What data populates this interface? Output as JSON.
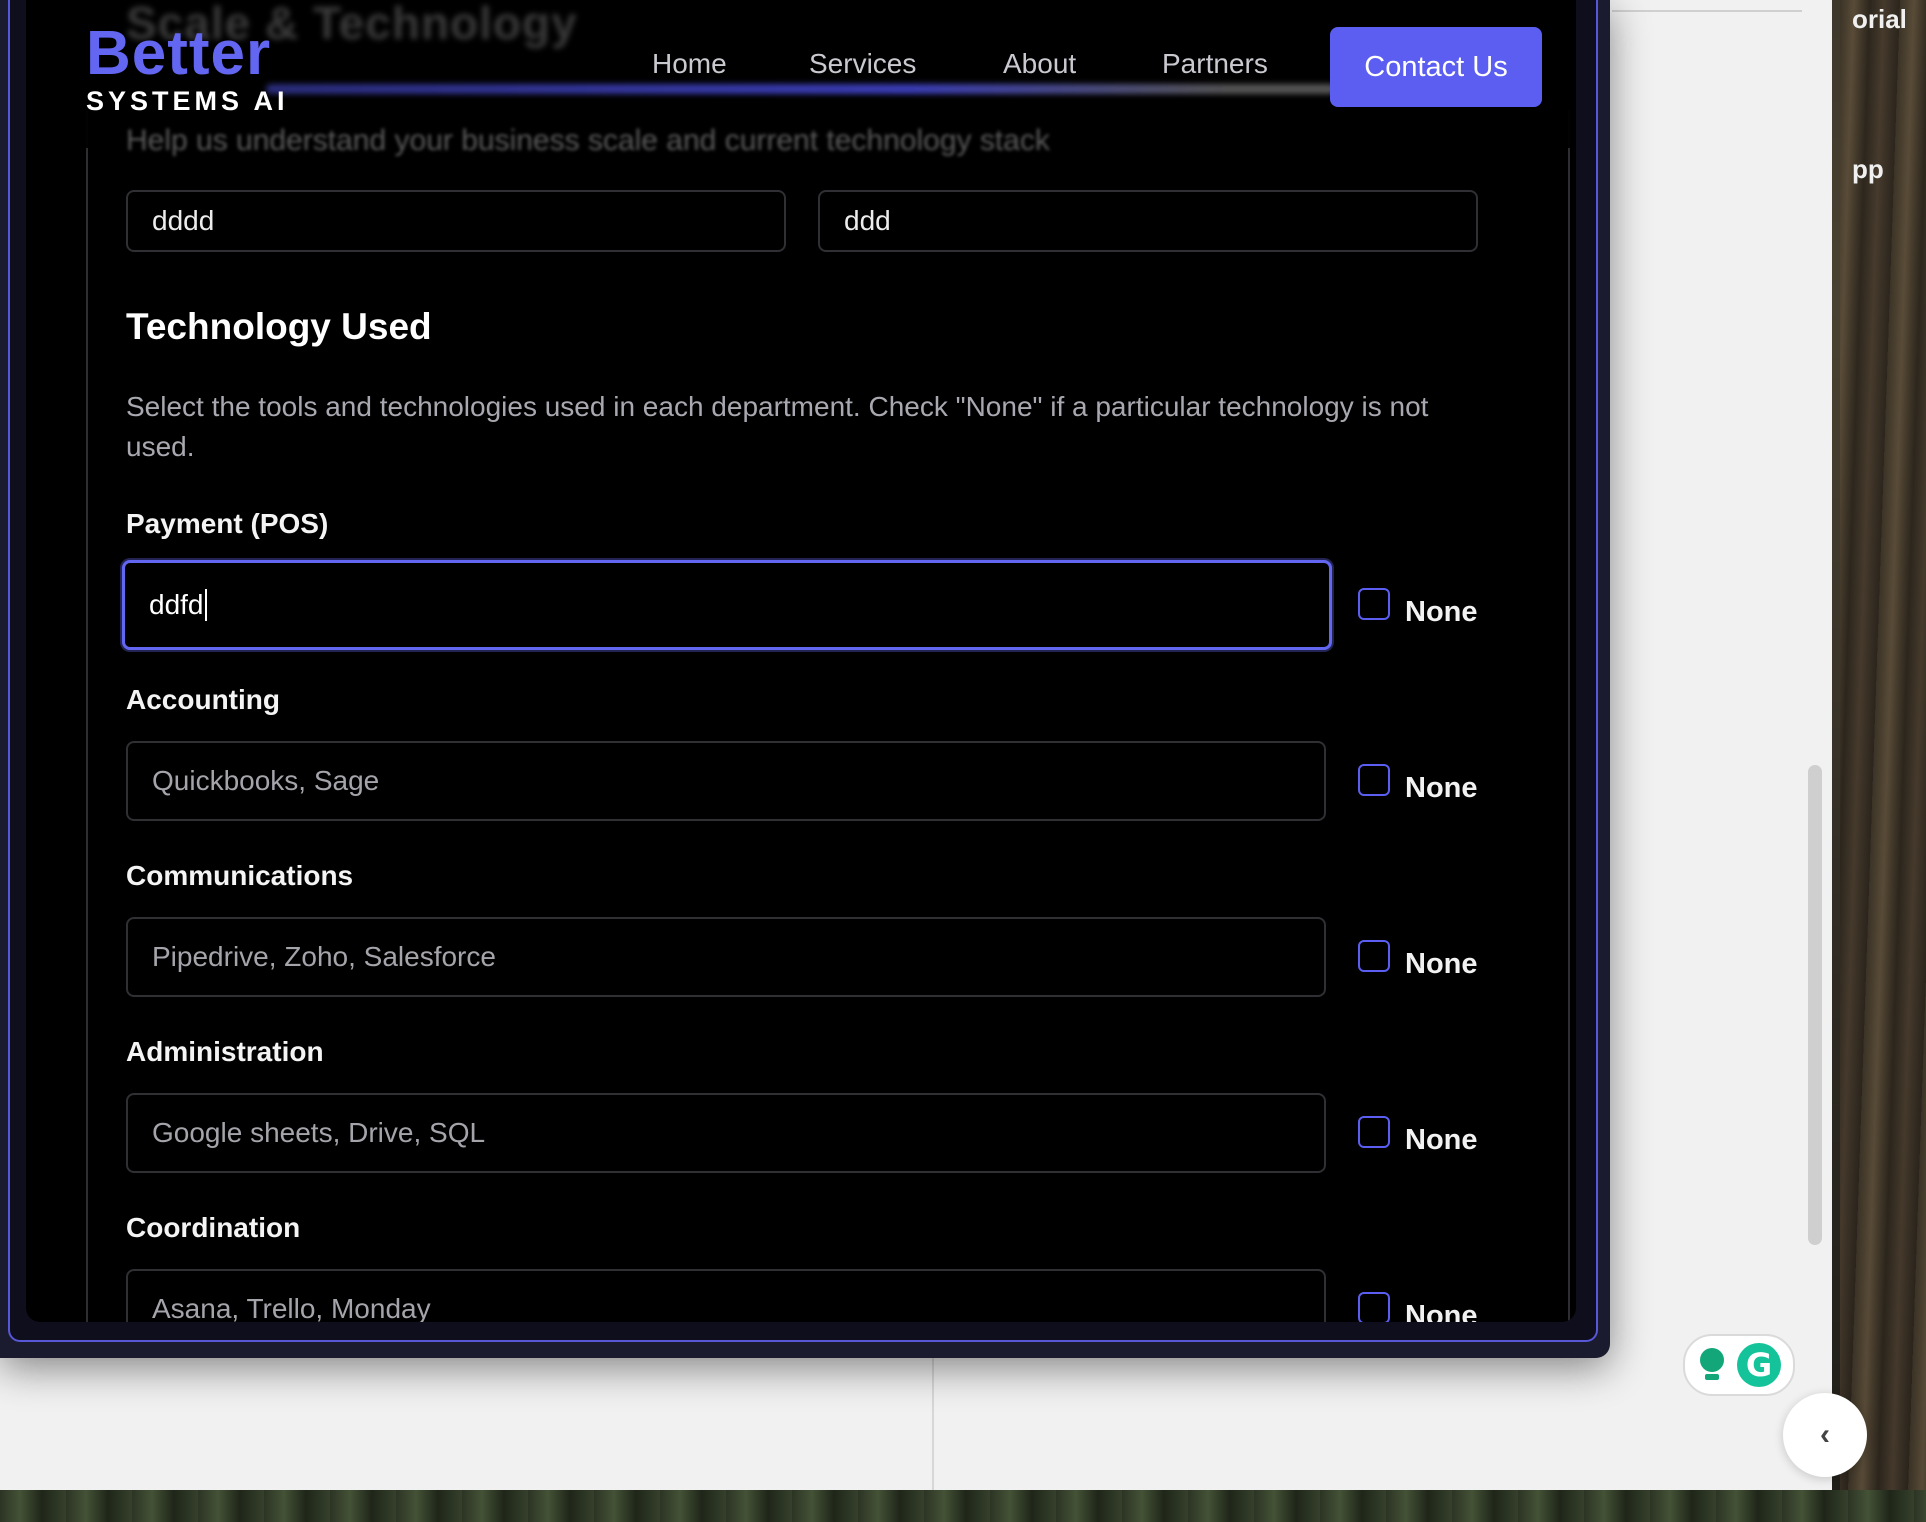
{
  "background": {
    "top_right_text": "orial",
    "mid_right_text": "pp"
  },
  "header": {
    "logo_main": "Better",
    "logo_sub": "SYSTEMS AI",
    "nav": [
      "Home",
      "Services",
      "About",
      "Partners"
    ],
    "contact_label": "Contact Us",
    "blurred_title": "Scale & Technology",
    "blurred_subtitle": "Help us understand your business scale and current technology stack"
  },
  "scale": {
    "field_1_value": "dddd",
    "field_2_value": "ddd"
  },
  "technology": {
    "title": "Technology Used",
    "description": "Select the tools and technologies used in each department. Check \"None\" if a particular technology is not used.",
    "none_label": "None",
    "fields": [
      {
        "label": "Payment (POS)",
        "value": "ddfd",
        "placeholder": "",
        "none_checked": false
      },
      {
        "label": "Accounting",
        "value": "",
        "placeholder": "Quickbooks, Sage",
        "none_checked": false
      },
      {
        "label": "Communications",
        "value": "",
        "placeholder": "Pipedrive, Zoho, Salesforce",
        "none_checked": false
      },
      {
        "label": "Administration",
        "value": "",
        "placeholder": "Google sheets, Drive, SQL",
        "none_checked": false
      },
      {
        "label": "Coordination",
        "value": "",
        "placeholder": "Asana, Trello, Monday",
        "none_checked": false
      }
    ]
  },
  "colors": {
    "accent": "#6366f1",
    "button": "#5b5ef0",
    "background": "#000000"
  },
  "icons": [
    "grammarly-bulb-icon",
    "grammarly-g-icon",
    "chevron-left-icon"
  ]
}
